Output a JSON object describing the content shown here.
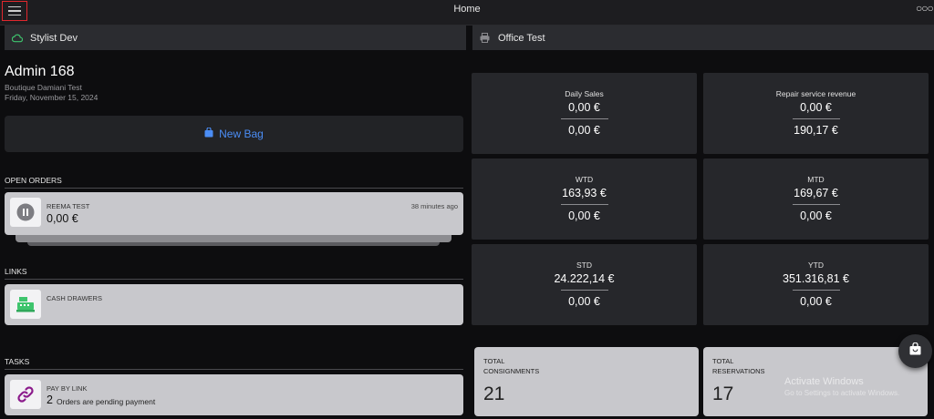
{
  "header": {
    "title": "Home",
    "menu_icon": "hamburger-icon",
    "more_icon": "more-horizontal-icon",
    "more_glyph": "○○○"
  },
  "stores": [
    {
      "label": "Stylist Dev",
      "icon": "cloud-icon",
      "color": "#3ec46d"
    },
    {
      "label": "Office Test",
      "icon": "printer-icon",
      "color": "#8a8a8e"
    }
  ],
  "user": {
    "name": "Admin 168",
    "store": "Boutique Damiani Test",
    "date": "Friday, November 15, 2024"
  },
  "new_bag": {
    "label": "New Bag",
    "icon": "shopping-bag-icon",
    "color": "#4b8df5"
  },
  "open_orders": {
    "heading": "OPEN ORDERS",
    "items": [
      {
        "name": "REEMA TEST",
        "amount": "0,00 €",
        "time": "38 minutes ago",
        "icon": "pause-icon"
      }
    ]
  },
  "links": {
    "heading": "LINKS",
    "items": [
      {
        "label": "CASH DRAWERS",
        "icon": "cash-register-icon",
        "color": "#3ec46d"
      }
    ]
  },
  "tasks": {
    "heading": "TASKS",
    "items": [
      {
        "label": "PAY BY LINK",
        "count": "2",
        "description": "Orders are pending payment",
        "icon": "link-icon",
        "color": "#8b1a8b"
      }
    ]
  },
  "stats": [
    {
      "label": "Daily Sales",
      "value1": "0,00 €",
      "value2": "0,00 €"
    },
    {
      "label": "Repair service revenue",
      "value1": "0,00 €",
      "value2": "190,17 €"
    },
    {
      "label": "WTD",
      "value1": "163,93 €",
      "value2": "0,00 €"
    },
    {
      "label": "MTD",
      "value1": "169,67 €",
      "value2": "0,00 €"
    },
    {
      "label": "STD",
      "value1": "24.222,14 €",
      "value2": "0,00 €"
    },
    {
      "label": "YTD",
      "value1": "351.316,81 €",
      "value2": "0,00 €"
    }
  ],
  "totals": [
    {
      "line1": "TOTAL",
      "line2": "CONSIGNMENTS",
      "value": "21"
    },
    {
      "line1": "TOTAL",
      "line2": "RESERVATIONS",
      "value": "17"
    }
  ],
  "fab": {
    "icon": "shopping-bag-icon"
  },
  "watermark": {
    "line1": "Activate Windows",
    "line2": "Go to Settings to activate Windows."
  }
}
